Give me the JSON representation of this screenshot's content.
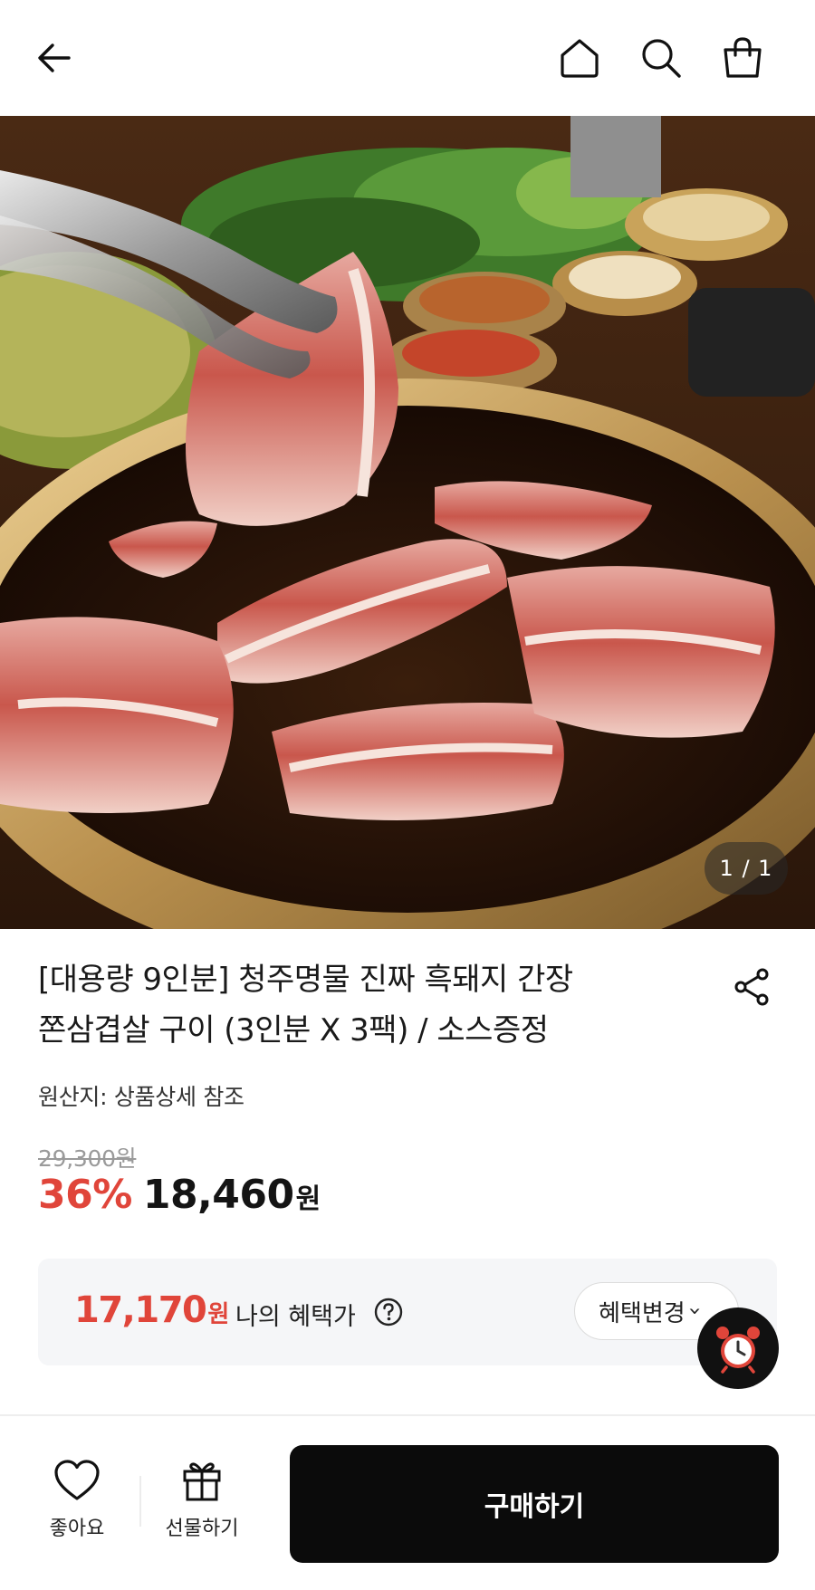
{
  "topbar": {
    "icons": [
      "back-arrow-icon",
      "home-icon",
      "search-icon",
      "shopping-bag-icon"
    ]
  },
  "hero": {
    "counter": "1 / 1",
    "image_subject": "pork-belly-in-soy-sauce-pan"
  },
  "product": {
    "title_line1": "[대용량 9인분] 청주명물 진짜 흑돼지 간장",
    "title_line2": "쫀삼겹살 구이 (3인분 X 3팩) / 소스증정",
    "origin": "원산지: 상품상세 참조",
    "original_price": "29,300원",
    "discount": "36%",
    "sale_price": "18,460",
    "currency": "원"
  },
  "benefit": {
    "price": "17,170",
    "unit": "원",
    "label": "나의 혜택가",
    "change_button": "혜택변경",
    "chevron": "›"
  },
  "bottom": {
    "like_label": "좋아요",
    "gift_label": "선물하기",
    "buy_label": "구매하기"
  },
  "colors": {
    "accent_red": "#e0453a",
    "button_dark": "#0b0b0b",
    "benefit_bg": "#f5f6f8"
  }
}
